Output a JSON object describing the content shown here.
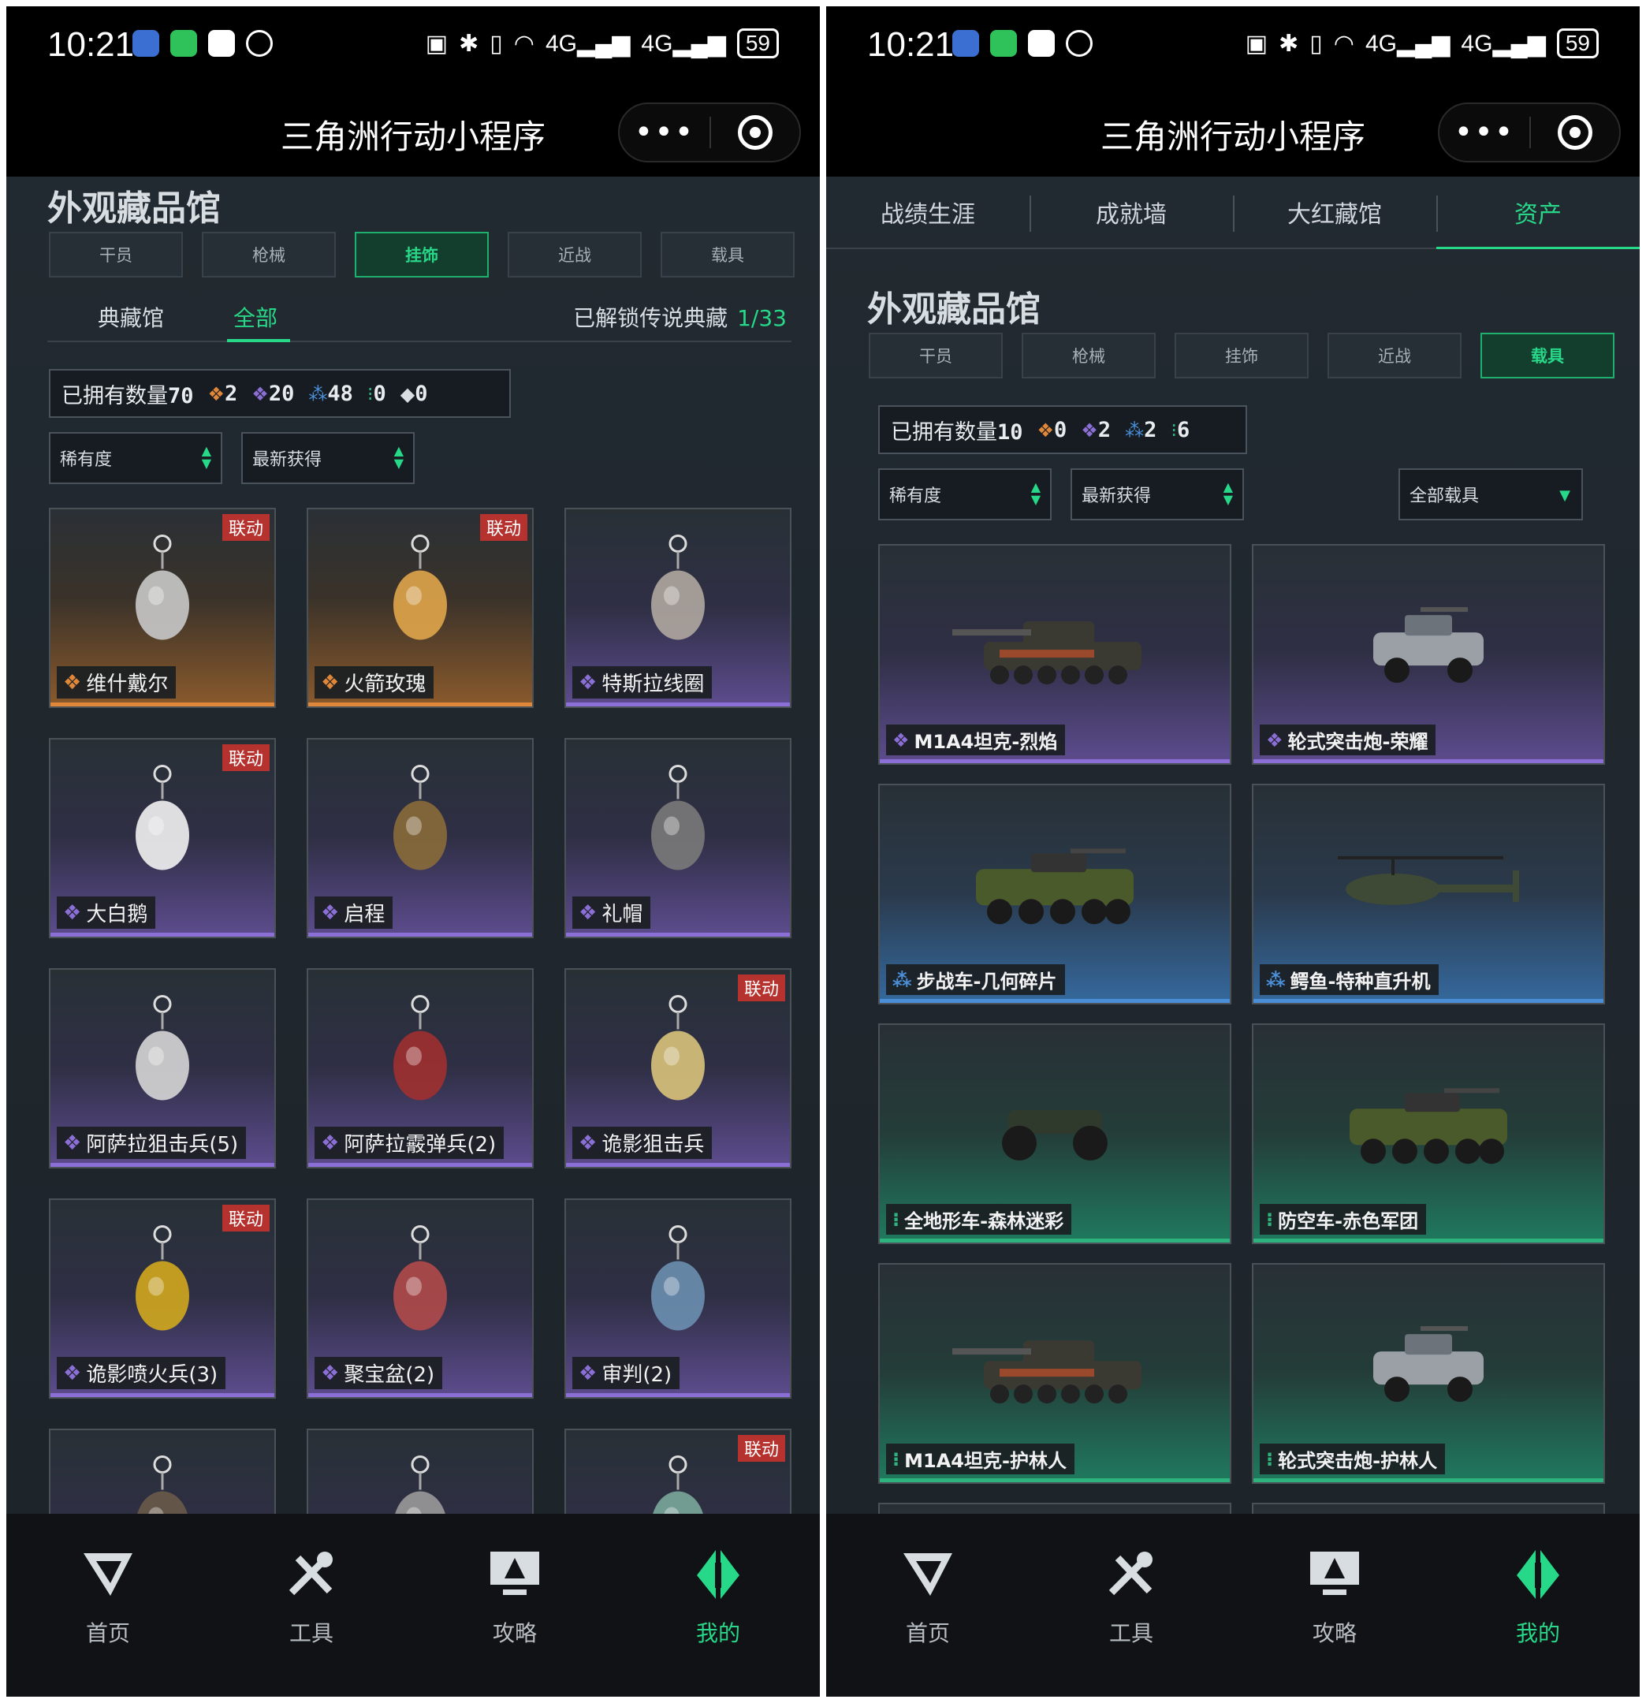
{
  "status_bar": {
    "time": "10:21",
    "network": "4G",
    "network2": "4G",
    "battery": "59"
  },
  "title_bar": {
    "title": "三角洲行动小程序",
    "more_label": "•••"
  },
  "left": {
    "section_title": "外观藏品馆",
    "category_tabs": [
      "干员",
      "枪械",
      "挂饰",
      "近战",
      "载具"
    ],
    "active_category": "挂饰",
    "filter": {
      "collection": "典藏馆",
      "all": "全部",
      "unlock_label": "已解锁传说典藏",
      "unlock_value": "1/33"
    },
    "owned": {
      "label": "已拥有数量",
      "total": "70",
      "counts": [
        "2",
        "20",
        "48",
        "0",
        "0"
      ]
    },
    "sort_rarity": "稀有度",
    "sort_recent": "最新获得",
    "items": [
      {
        "name": "维什戴尔",
        "tag": "联动",
        "rarity": "orange"
      },
      {
        "name": "火箭玫瑰",
        "tag": "联动",
        "rarity": "orange"
      },
      {
        "name": "特斯拉线圈",
        "tag": "",
        "rarity": "purple"
      },
      {
        "name": "大白鹅",
        "tag": "联动",
        "rarity": "purple"
      },
      {
        "name": "启程",
        "tag": "",
        "rarity": "purple"
      },
      {
        "name": "礼帽",
        "tag": "",
        "rarity": "purple"
      },
      {
        "name": "阿萨拉狙击兵(5)",
        "tag": "",
        "rarity": "purple"
      },
      {
        "name": "阿萨拉霰弹兵(2)",
        "tag": "",
        "rarity": "purple"
      },
      {
        "name": "诡影狙击兵",
        "tag": "联动",
        "rarity": "purple"
      },
      {
        "name": "诡影喷火兵(3)",
        "tag": "联动",
        "rarity": "purple"
      },
      {
        "name": "聚宝盆(2)",
        "tag": "",
        "rarity": "purple"
      },
      {
        "name": "审判(2)",
        "tag": "",
        "rarity": "purple"
      },
      {
        "name": "",
        "tag": "",
        "rarity": "purple"
      },
      {
        "name": "",
        "tag": "",
        "rarity": "purple"
      },
      {
        "name": "",
        "tag": "联动",
        "rarity": "purple"
      }
    ]
  },
  "right": {
    "top_tabs": [
      "战绩生涯",
      "成就墙",
      "大红藏馆",
      "资产"
    ],
    "active_top_tab": "资产",
    "section_title": "外观藏品馆",
    "category_tabs": [
      "干员",
      "枪械",
      "挂饰",
      "近战",
      "载具"
    ],
    "active_category": "载具",
    "owned": {
      "label": "已拥有数量",
      "total": "10",
      "counts": [
        "0",
        "2",
        "2",
        "6"
      ]
    },
    "sort_rarity": "稀有度",
    "sort_recent": "最新获得",
    "vehicle_filter": "全部载具",
    "items": [
      {
        "name": "M1A4坦克-烈焰",
        "rarity": "purple",
        "kind": "tank"
      },
      {
        "name": "轮式突击炮-荣耀",
        "rarity": "purple",
        "kind": "jeep"
      },
      {
        "name": "步战车-几何碎片",
        "rarity": "blue",
        "kind": "apc"
      },
      {
        "name": "鳄鱼-特种直升机",
        "rarity": "blue",
        "kind": "heli"
      },
      {
        "name": "全地形车-森林迷彩",
        "rarity": "green",
        "kind": "atv"
      },
      {
        "name": "防空车-赤色军团",
        "rarity": "green",
        "kind": "apc"
      },
      {
        "name": "M1A4坦克-护林人",
        "rarity": "green",
        "kind": "tank"
      },
      {
        "name": "轮式突击炮-护林人",
        "rarity": "green",
        "kind": "jeep"
      },
      {
        "name": "",
        "rarity": "green",
        "kind": ""
      },
      {
        "name": "",
        "rarity": "green",
        "kind": ""
      }
    ]
  },
  "bottom_nav": [
    {
      "label": "首页",
      "icon": "home-logo-icon"
    },
    {
      "label": "工具",
      "icon": "tools-icon"
    },
    {
      "label": "攻略",
      "icon": "guide-monitor-icon"
    },
    {
      "label": "我的",
      "icon": "profile-logo-icon"
    }
  ],
  "colors": {
    "accent": "#28d889",
    "orange": "#e0873a",
    "purple": "#8b6fd6",
    "blue": "#4a8fd8",
    "green": "#2fb37e",
    "collab_tag": "#b5322f"
  }
}
